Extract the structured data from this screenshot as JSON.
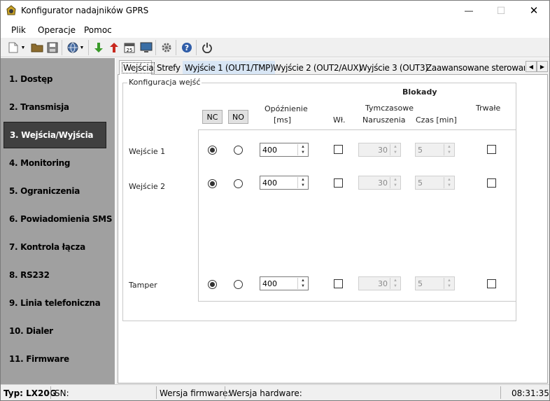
{
  "window": {
    "title": "Konfigurator nadajników GPRS",
    "min_glyph": "—",
    "max_glyph": "☐",
    "close_glyph": "✕"
  },
  "menu": [
    "Plik",
    "Operacje",
    "Pomoc"
  ],
  "toolbar_icons": [
    "new-file-icon",
    "dropdown-arrow-icon",
    "open-folder-icon",
    "save-icon",
    "globe-icon",
    "dropdown-arrow-icon",
    "download-icon",
    "upload-icon",
    "calendar-icon",
    "monitor-icon",
    "settings-gear-icon",
    "help-icon",
    "power-icon"
  ],
  "calendar_day": "25",
  "sidebar": {
    "items": [
      {
        "label": "1. Dostęp"
      },
      {
        "label": "2. Transmisja"
      },
      {
        "label": "3. Wejścia/Wyjścia",
        "active": true
      },
      {
        "label": "4. Monitoring"
      },
      {
        "label": "5. Ograniczenia"
      },
      {
        "label": "6. Powiadomienia SMS"
      },
      {
        "label": "7. Kontrola łącza"
      },
      {
        "label": "8. RS232"
      },
      {
        "label": "9. Linia telefoniczna"
      },
      {
        "label": "10. Dialer"
      },
      {
        "label": "11. Firmware"
      }
    ]
  },
  "tabs": [
    {
      "label": "Wejścia",
      "selected": true
    },
    {
      "label": "Strefy"
    },
    {
      "label": "Wyjście 1 (OUT1/TMP)"
    },
    {
      "label": "Wyjście 2 (OUT2/AUX)"
    },
    {
      "label": "Wyjście 3 (OUT3)"
    },
    {
      "label": "Zaawansowane sterowanie w"
    }
  ],
  "tab_scroll": {
    "left": "◀",
    "right": "▶"
  },
  "group": {
    "legend": "Konfiguracja wejść",
    "blokady_header": "Blokady",
    "nc_button": "NC",
    "no_button": "NO",
    "delay_header_1": "Opóźnienie",
    "delay_header_2": "[ms]",
    "wl_header": "Wł.",
    "temp_header": "Tymczasowe",
    "violations_header": "Naruszenia",
    "time_header": "Czas [min]",
    "permanent_header": "Trwałe"
  },
  "rows": [
    {
      "label": "Wejście 1",
      "nc": true,
      "no": false,
      "delay": "400",
      "wl": false,
      "violations": "30",
      "time": "5",
      "permanent": false
    },
    {
      "label": "Wejście 2",
      "nc": true,
      "no": false,
      "delay": "400",
      "wl": false,
      "violations": "30",
      "time": "5",
      "permanent": false
    },
    {
      "label": "Tamper",
      "nc": true,
      "no": false,
      "delay": "400",
      "wl": false,
      "violations": "30",
      "time": "5",
      "permanent": false
    }
  ],
  "status": {
    "type": "Typ: LX20G",
    "sn": "SN:",
    "firmware": "Wersja firmware:",
    "hardware": "Wersja hardware:",
    "time": "08:31:35"
  }
}
